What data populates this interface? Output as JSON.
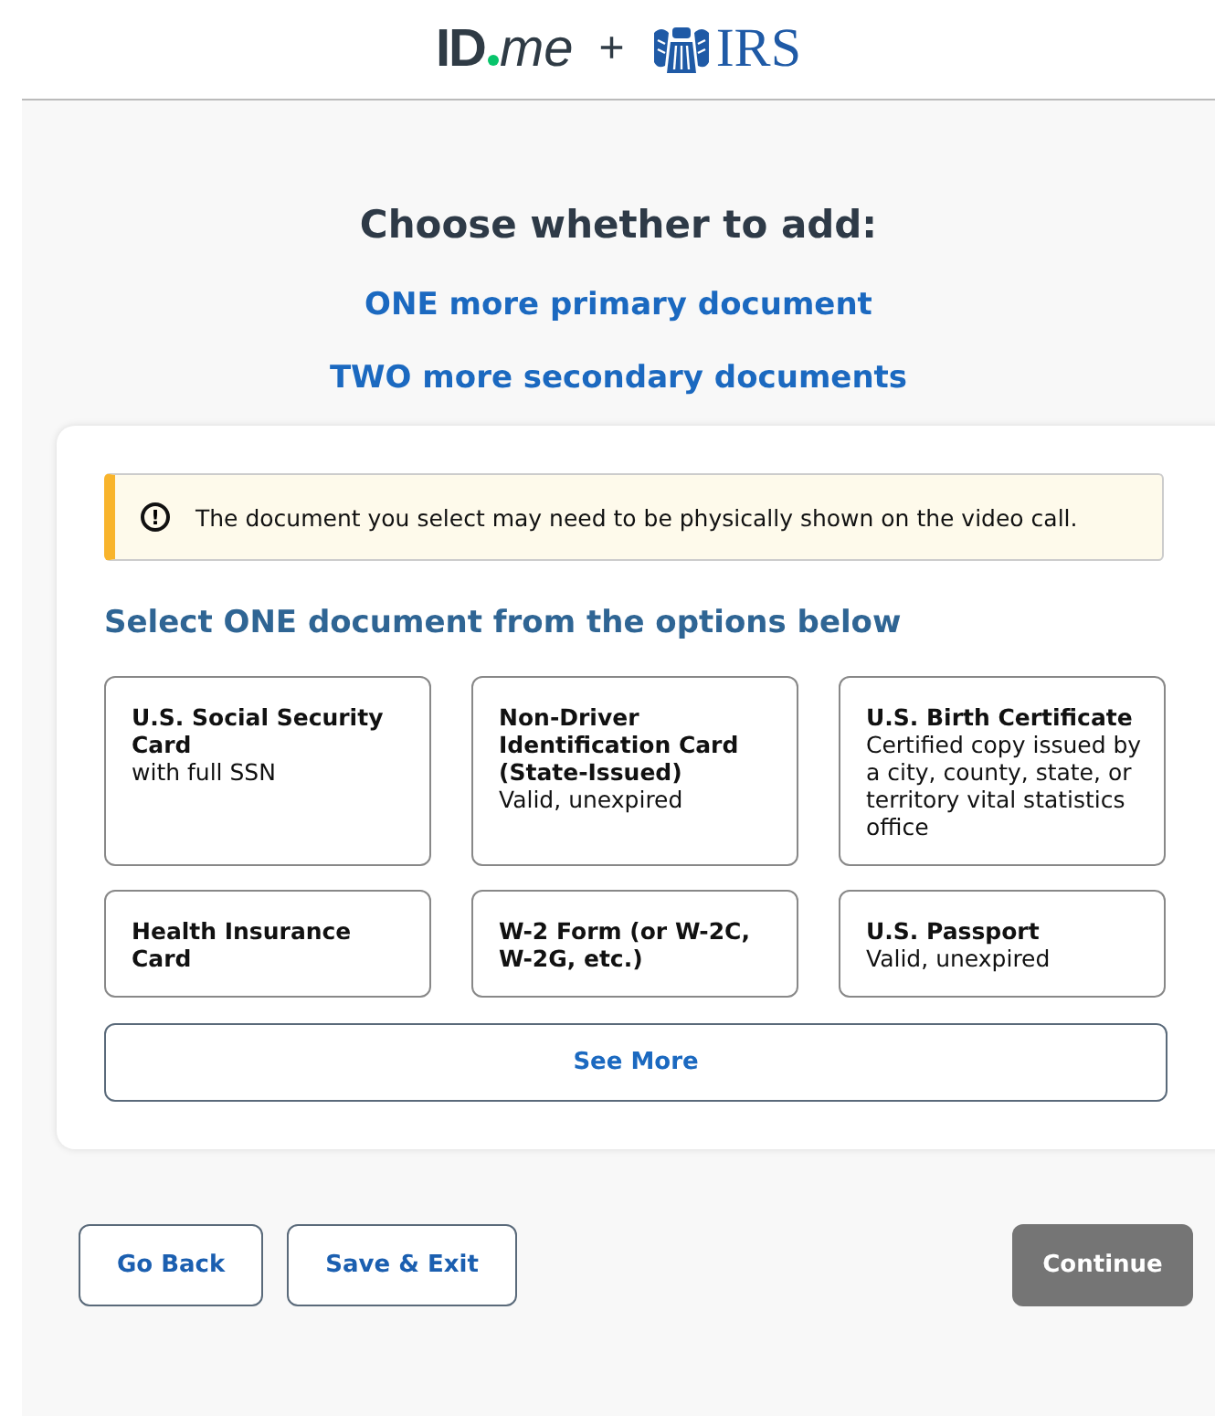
{
  "header": {
    "brand": "ID",
    "brand_suffix": "me",
    "plus": "+",
    "partner": "IRS"
  },
  "prompt": "Choose whether to add:",
  "options": [
    {
      "label": "ONE more primary document"
    },
    {
      "label": "TWO more secondary documents"
    }
  ],
  "alert": {
    "icon": "!",
    "text": "The document you select may need to be physically shown on the video call."
  },
  "section_title": "Select ONE document from the options below",
  "documents": [
    {
      "title": "U.S. Social Security Card",
      "detail": "with full SSN"
    },
    {
      "title": "Non-Driver Identification Card (State-Issued)",
      "detail": "Valid, unexpired"
    },
    {
      "title": "U.S. Birth Certificate",
      "detail": "Certified copy issued by a city, county, state, or territory vital statistics office"
    },
    {
      "title": "Health Insurance Card"
    },
    {
      "title": "W-2 Form (or W-2C, W-2G, etc.)"
    },
    {
      "title": "U.S. Passport",
      "detail": "Valid, unexpired"
    }
  ],
  "see_more": "See More",
  "footer": {
    "back": "Go Back",
    "save": "Save & Exit",
    "continue": {
      "label": "Continue",
      "disabled": true
    }
  }
}
